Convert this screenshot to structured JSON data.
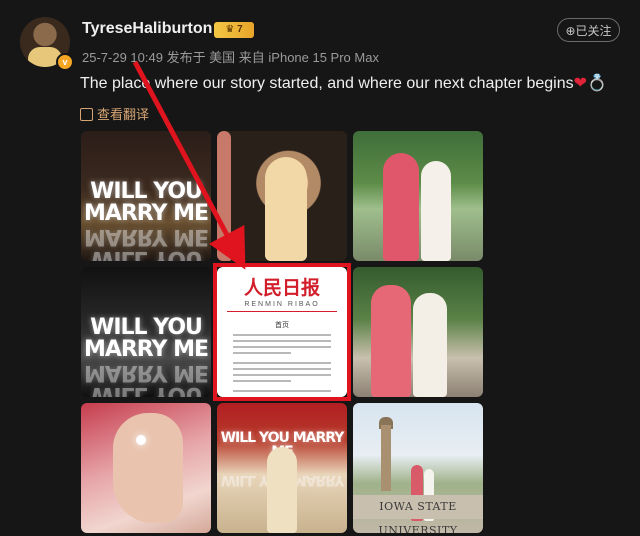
{
  "post": {
    "username": "TyreseHaliburton",
    "vip_level": "7",
    "verified_mark": "v",
    "meta": "25-7-29 10:49 发布于 美国 来自 iPhone 15 Pro Max",
    "follow_label": "⊕已关注",
    "text": "The place where our story started, and where our next chapter begins",
    "emoji_heart": "❤",
    "emoji_ring": "💍",
    "translate_label": "查看翻译"
  },
  "images": {
    "tile1_text": "WILL YOU MARRY ME",
    "tile4_text": "WILL YOU MARRY ME",
    "tile8_text": "WILL YOU MARRY ME",
    "tile9_sign": "IOWA STATE UNIVERSITY",
    "newspaper_title": "人民日报",
    "newspaper_sub": "RENMIN RIBAO",
    "newspaper_heading": "首页"
  },
  "colors": {
    "background": "#161616",
    "highlight": "#e0141e",
    "arrow": "#e0141e",
    "translate": "#d6a574",
    "vip_badge": "#f3c744"
  },
  "icons": {
    "vip": "crown-icon",
    "verified": "verified-badge-icon",
    "translate": "translate-icon",
    "heart": "heart-emoji",
    "ring": "ring-emoji"
  }
}
